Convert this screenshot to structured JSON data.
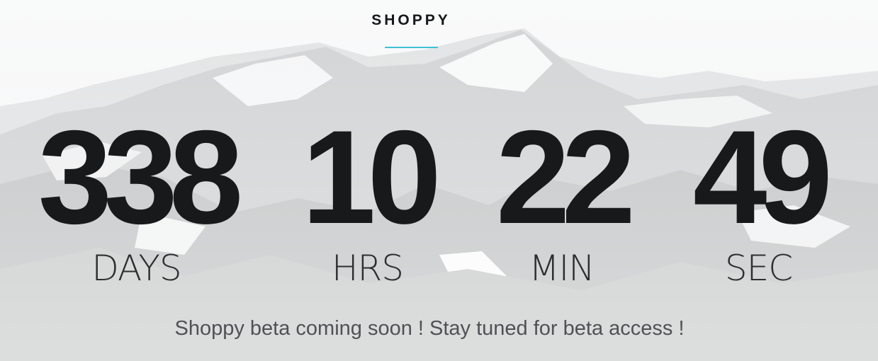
{
  "header": {
    "brand": "SHOPPY"
  },
  "countdown": {
    "days": {
      "value": "338",
      "label": "DAYS"
    },
    "hours": {
      "value": "10",
      "label": "HRS"
    },
    "minutes": {
      "value": "22",
      "label": "MIN"
    },
    "seconds": {
      "value": "49",
      "label": "SEC"
    }
  },
  "message": "Shoppy beta coming soon ! Stay tuned for beta access !",
  "colors": {
    "accent": "#3fc0d4",
    "numbers": "#17191b",
    "tagline": "#4f5255"
  }
}
